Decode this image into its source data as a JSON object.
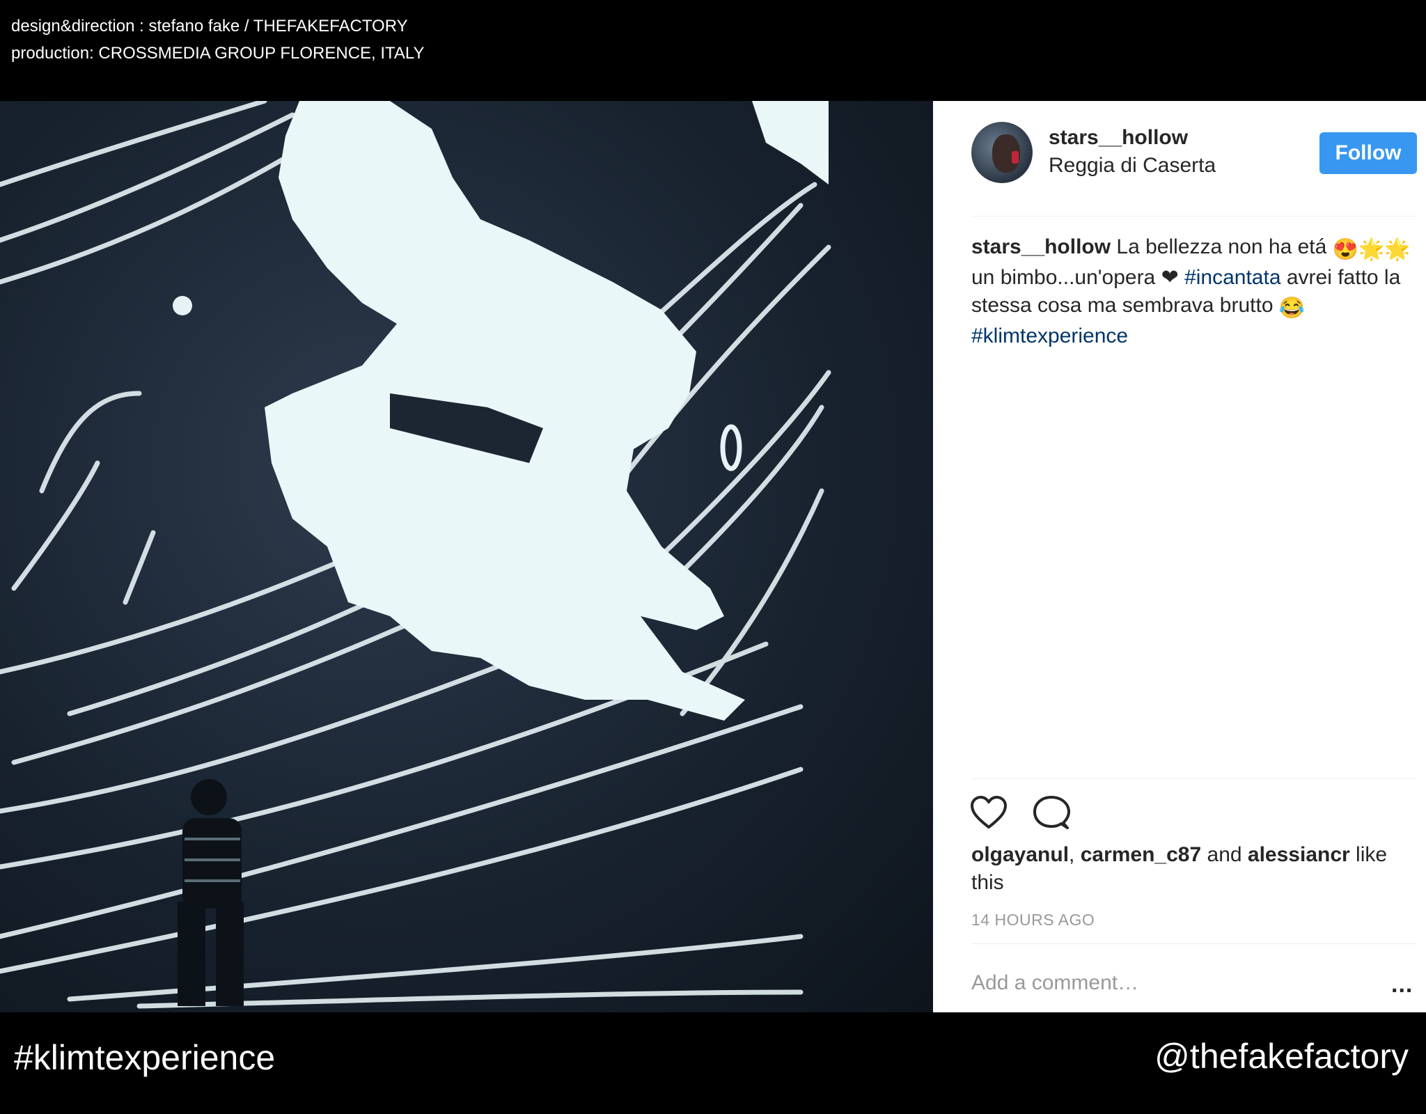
{
  "credits": {
    "line1": "design&direction : stefano fake / THEFAKEFACTORY",
    "line2": "production: CROSSMEDIA GROUP FLORENCE, ITALY"
  },
  "post": {
    "username": "stars__hollow",
    "location": "Reggia di Caserta",
    "follow_label": "Follow",
    "caption": {
      "user": "stars__hollow",
      "text_1": " La bellezza non ha etá ",
      "emoji_1": "😍🌟🌟",
      "text_2": "un bimbo...un'opera ",
      "heart": "❤",
      "tag_1": "#incantata",
      "text_3": " avrei fatto la stessa cosa ma sembrava brutto ",
      "emoji_2": "😂",
      "tag_2": "#klimtexperience"
    },
    "likes": {
      "user_1": "olgayanul",
      "comma": ", ",
      "user_2": "carmen_c87",
      "and": " and ",
      "user_3": "alessiancr",
      "suffix": " like this"
    },
    "time": "14 HOURS AGO",
    "comment_placeholder": "Add a comment…",
    "more": "..."
  },
  "footer": {
    "hashtag": "#klimtexperience",
    "handle": "@thefakefactory"
  },
  "icons": {
    "like": "heart-outline-icon",
    "comment": "speech-bubble-icon",
    "more": "ellipsis-icon"
  },
  "colors": {
    "follow_button": "#3897f0",
    "hashtag_link": "#003569",
    "muted_text": "#999999",
    "photo_background": "#17212d"
  }
}
